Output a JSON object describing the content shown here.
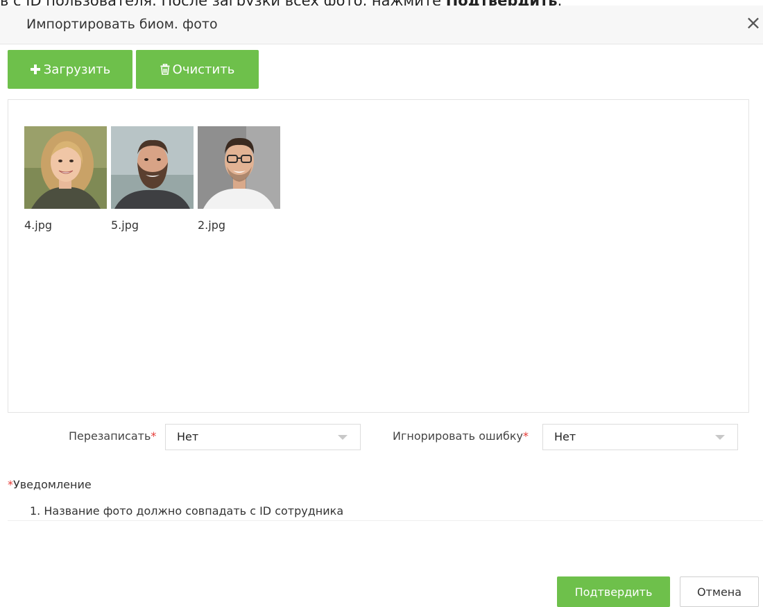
{
  "background_instruction": {
    "prefix": "в с ID пользователя. После загрузки всех фото, нажмите ",
    "emphasis": "Подтвердить",
    "suffix": "."
  },
  "dialog": {
    "title": "Импортировать биом. фото",
    "close_icon": "close-icon"
  },
  "toolbar": {
    "upload_label": "Загрузить",
    "upload_icon": "plus-icon",
    "clear_label": "Очистить",
    "clear_icon": "trash-icon"
  },
  "photos": [
    {
      "filename": "4.jpg"
    },
    {
      "filename": "5.jpg"
    },
    {
      "filename": "2.jpg"
    }
  ],
  "form": {
    "overwrite": {
      "label": "Перезаписать",
      "required_mark": "*",
      "value": "Нет"
    },
    "ignore_error": {
      "label": "Игнорировать ошибку",
      "required_mark": "*",
      "value": "Нет"
    }
  },
  "notice": {
    "required_mark": "*",
    "title": "Уведомление",
    "items": [
      "1. Название фото должно совпадать с ID сотрудника"
    ]
  },
  "footer": {
    "confirm_label": "Подтвердить",
    "cancel_label": "Отмена"
  },
  "colors": {
    "accent_green": "#6ec04b",
    "required_red": "#e53935"
  }
}
